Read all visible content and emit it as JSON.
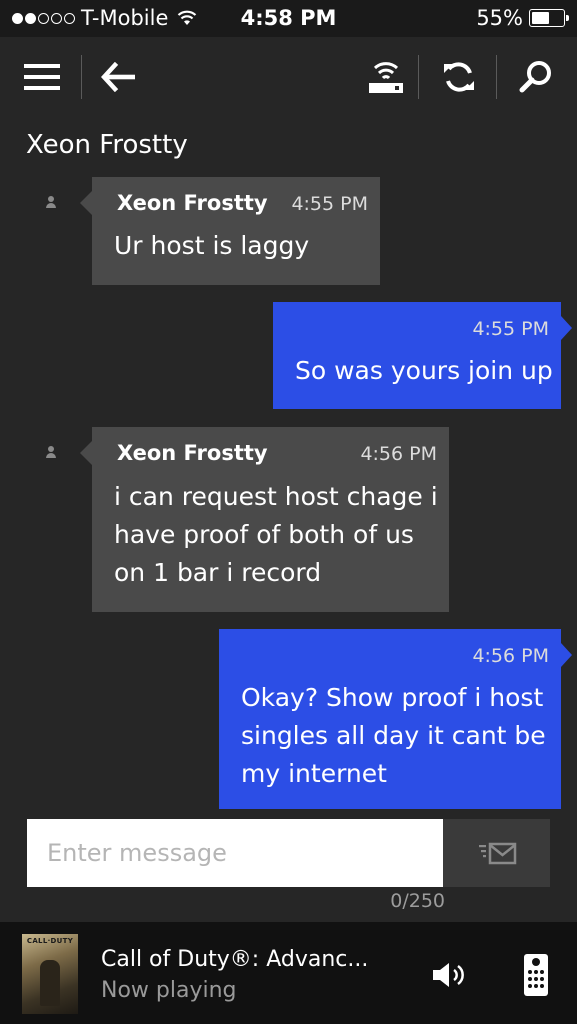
{
  "status_bar": {
    "carrier": "T-Mobile",
    "signal_bars_filled": 2,
    "signal_bars_total": 5,
    "time": "4:58 PM",
    "battery_label": "55%",
    "battery_level": 0.55
  },
  "nav": {
    "icons": [
      "menu-icon",
      "back-arrow-icon",
      "network-icon",
      "refresh-icon",
      "search-icon"
    ]
  },
  "conversation": {
    "title": "Xeon Frostty",
    "messages": [
      {
        "direction": "incoming",
        "sender": "Xeon Frostty",
        "time": "4:55 PM",
        "lines": [
          "Ur host is laggy"
        ]
      },
      {
        "direction": "outgoing",
        "time": "4:55 PM",
        "lines": [
          "So was yours join up"
        ]
      },
      {
        "direction": "incoming",
        "sender": "Xeon Frostty",
        "time": "4:56 PM",
        "lines": [
          "i can request host chage i",
          "have proof of both of us",
          "on 1 bar i record"
        ]
      },
      {
        "direction": "outgoing",
        "time": "4:56 PM",
        "lines": [
          "Okay? Show proof i host",
          "singles all day it cant be",
          "my internet"
        ]
      }
    ]
  },
  "composer": {
    "placeholder": "Enter message",
    "value": "",
    "char_count": "0/250"
  },
  "now_playing": {
    "art_text": "CALL·DUTY",
    "title": "Call of Duty®: Advanc...",
    "status": "Now playing"
  },
  "colors": {
    "background": "#262626",
    "incoming_bubble": "#4a4a4a",
    "outgoing_bubble": "#2c4ee6",
    "bar": "#111111"
  }
}
